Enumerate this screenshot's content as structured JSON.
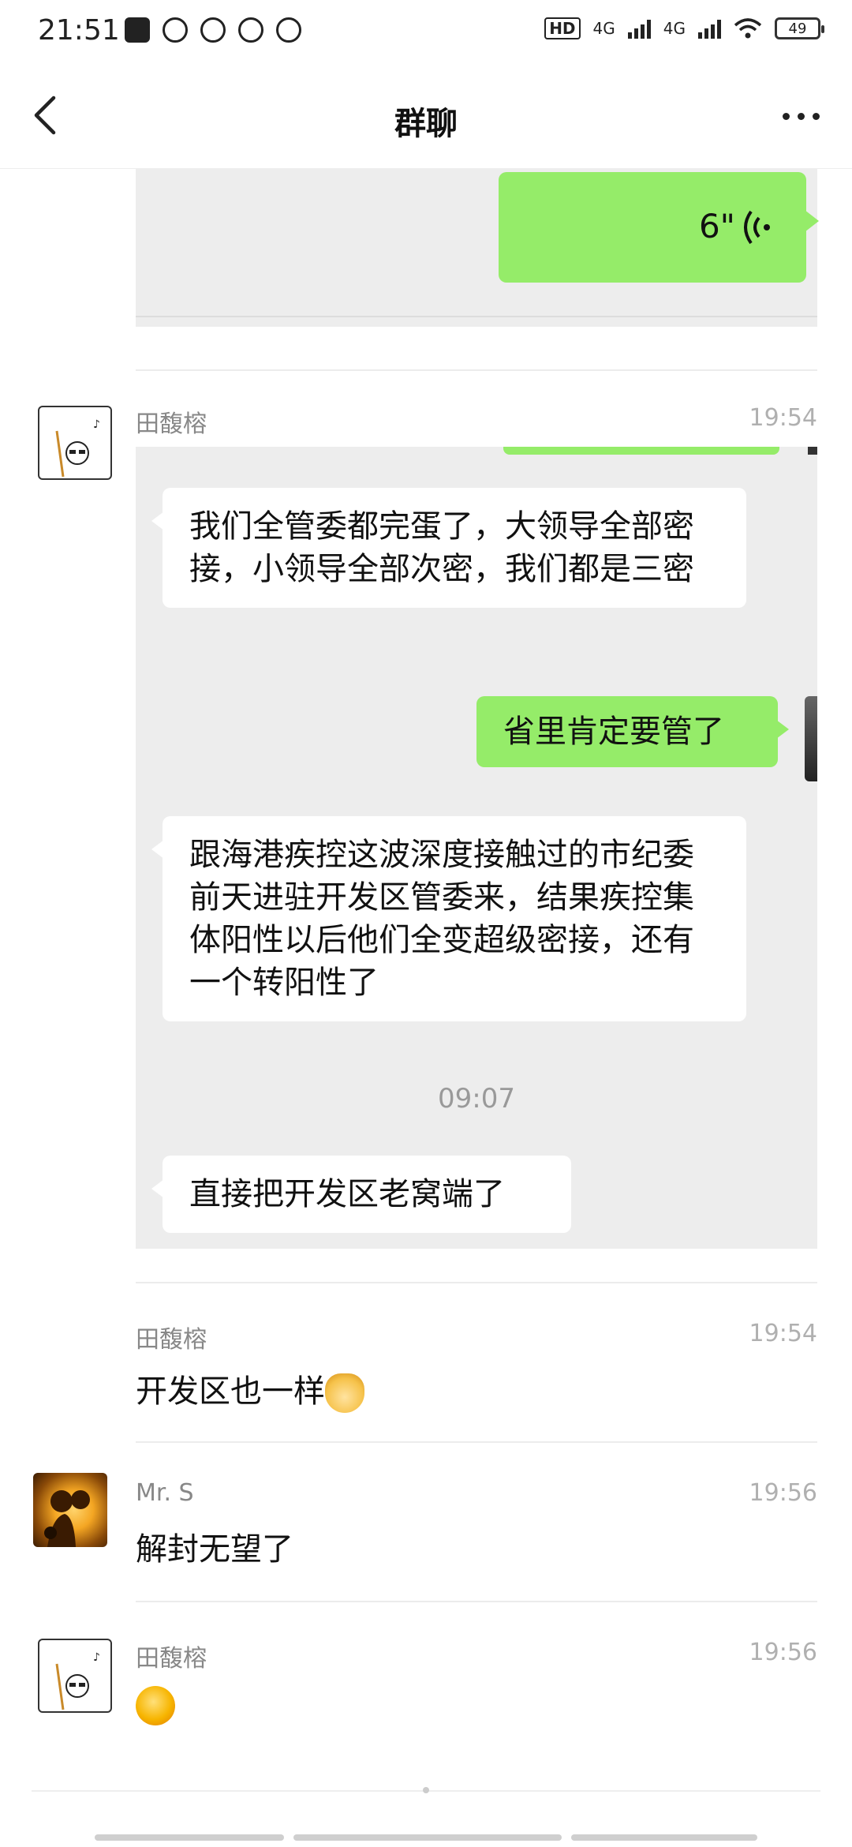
{
  "status_bar": {
    "time": "21:51",
    "network_hd": "HD",
    "network_1": "4G",
    "network_2": "4G",
    "battery": "49"
  },
  "header": {
    "title": "群聊",
    "back_icon": "chevron-left-icon",
    "more_icon": "more-horizontal-icon"
  },
  "top_card": {
    "voice_duration": "6\""
  },
  "card": {
    "messages": [
      "我们全管委都完蛋了，大领导全部密接，小领导全部次密，我们都是三密",
      "省里肯定要管了",
      "跟海港疾控这波深度接触过的市纪委前天进驻开发区管委来，结果疾控集体阳性以后他们全变超级密接，还有一个转阳性了",
      "直接把开发区老窝端了"
    ],
    "time_divider": "09:07"
  },
  "messages": [
    {
      "sender": "田馥榕",
      "time": "19:54"
    },
    {
      "sender": "田馥榕",
      "time": "19:54",
      "text": "开发区也一样"
    },
    {
      "sender": "Mr. S",
      "time": "19:56",
      "text": "解封无望了"
    },
    {
      "sender": "田馥榕",
      "time": "19:56"
    }
  ],
  "colors": {
    "accent_green": "#95ec69",
    "card_bg": "#ededed"
  }
}
